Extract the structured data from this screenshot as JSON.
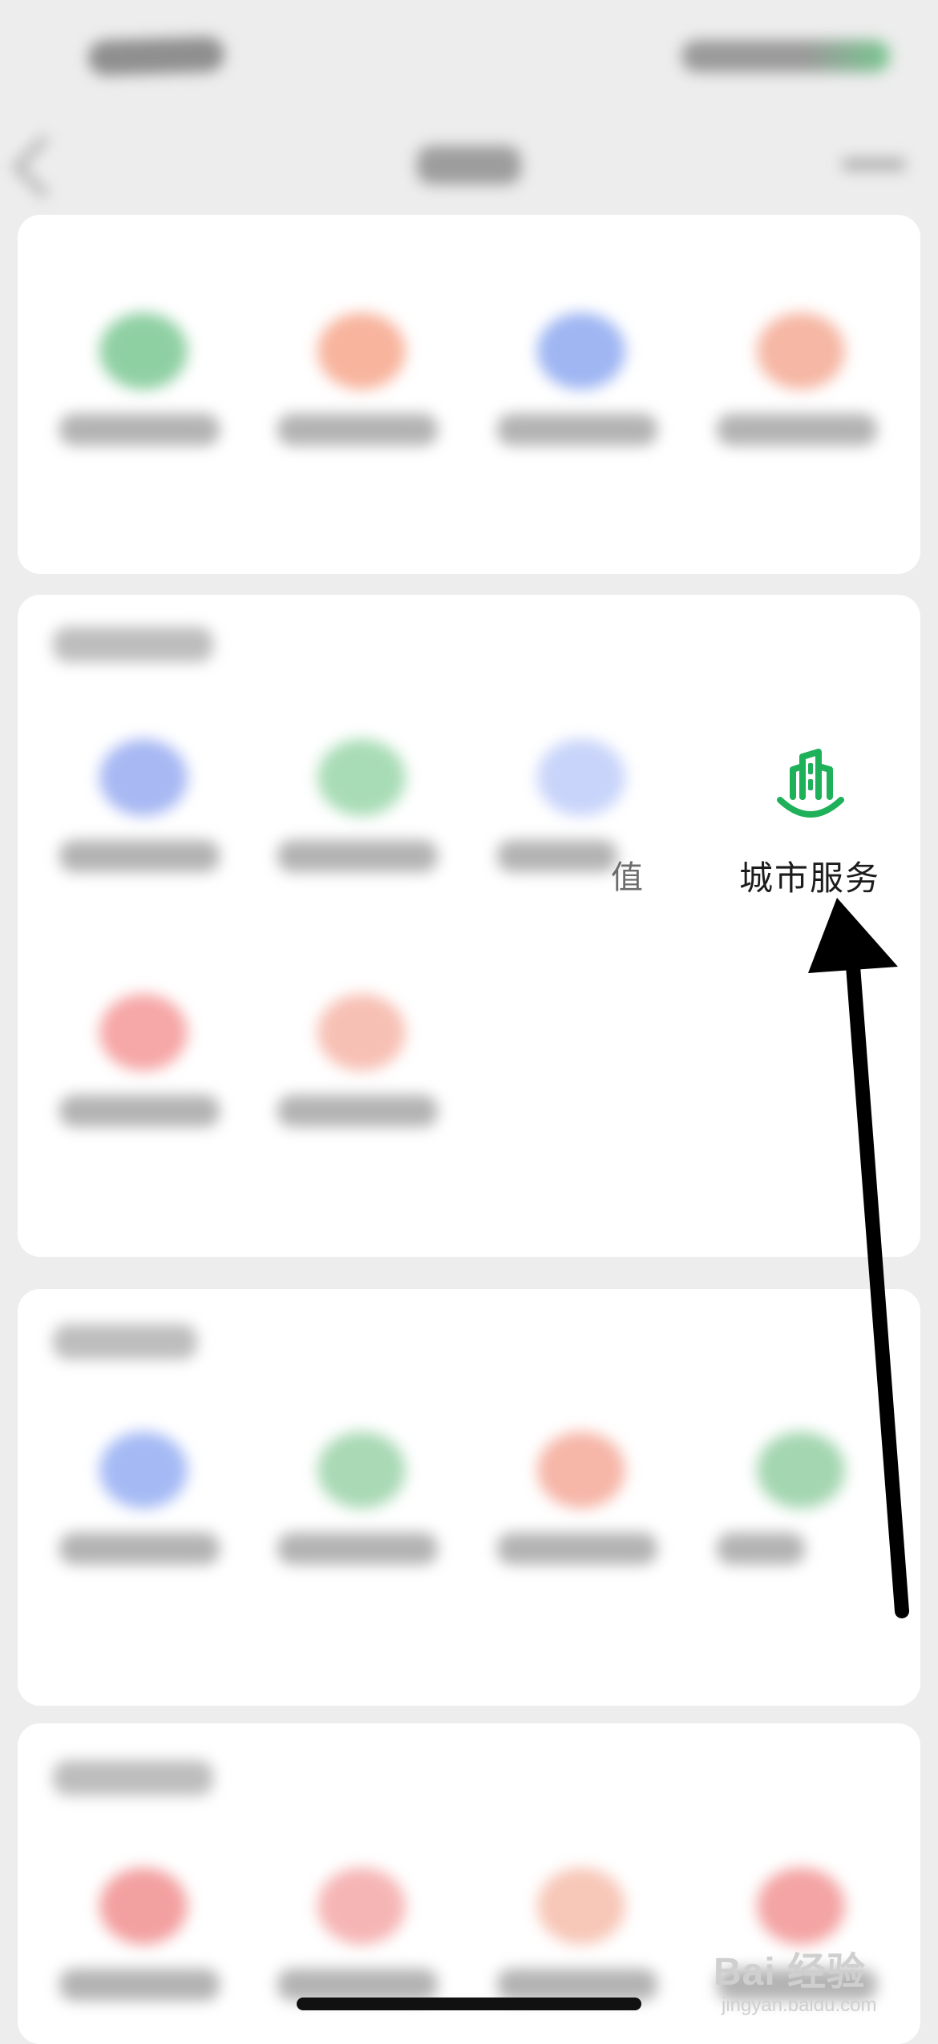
{
  "city_service": {
    "label": "城市服务",
    "icon": "city-building-icon",
    "color": "#1fb05a"
  },
  "partial_text": "值",
  "watermark": {
    "brand": "Bai 经验",
    "url": "jingyan.baidu.com"
  },
  "colors": {
    "background": "#ededed",
    "card": "#ffffff",
    "arrow": "#000000"
  }
}
